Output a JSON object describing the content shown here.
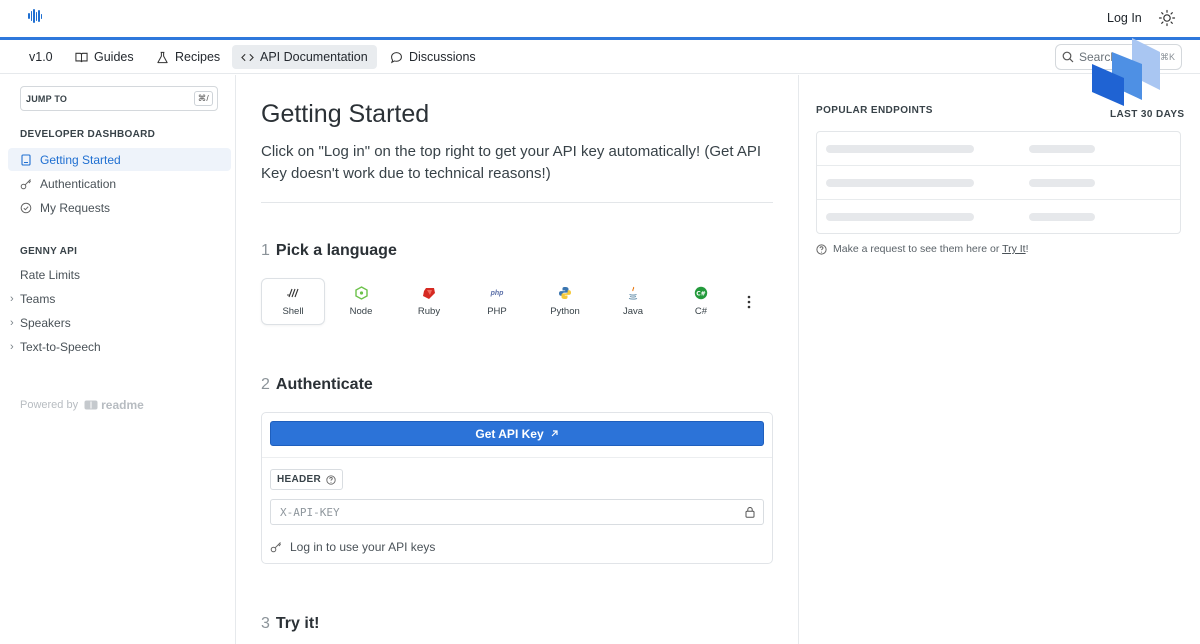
{
  "topbar": {
    "login_label": "Log In",
    "theme_icon": "sun-icon"
  },
  "nav": {
    "version": "v1.0",
    "items": [
      {
        "label": "Guides",
        "icon": "book-icon"
      },
      {
        "label": "Recipes",
        "icon": "flask-icon"
      },
      {
        "label": "API Documentation",
        "icon": "code-icon",
        "active": true
      },
      {
        "label": "Discussions",
        "icon": "chat-bubble-icon"
      }
    ],
    "search_placeholder": "Search",
    "search_shortcut": "⌘K"
  },
  "sidebar": {
    "jump_label": "JUMP TO",
    "jump_shortcut": "⌘/",
    "section1_title": "DEVELOPER DASHBOARD",
    "section1_items": [
      {
        "label": "Getting Started",
        "icon": "page-icon",
        "active": true
      },
      {
        "label": "Authentication",
        "icon": "key-icon"
      },
      {
        "label": "My Requests",
        "icon": "check-circle-icon"
      }
    ],
    "section2_title": "GENNY API",
    "rate_limits": "Rate Limits",
    "tree_items": [
      "Teams",
      "Speakers",
      "Text-to-Speech"
    ],
    "powered_by": "Powered by",
    "powered_brand": "readme"
  },
  "main": {
    "title": "Getting Started",
    "intro": "Click on \"Log in\" on the top right to get your API key automatically! (Get API Key doesn't work due to technical reasons!)",
    "step1": {
      "num": "1",
      "label": "Pick a language"
    },
    "step2": {
      "num": "2",
      "label": "Authenticate"
    },
    "step3": {
      "num": "3",
      "label": "Try it!"
    },
    "languages": [
      "Shell",
      "Node",
      "Ruby",
      "PHP",
      "Python",
      "Java",
      "C#"
    ],
    "api_button": "Get API Key",
    "header_tag": "HEADER",
    "key_placeholder": "X-API-KEY",
    "login_hint": "Log in to use your API keys"
  },
  "right": {
    "popular_title": "POPULAR ENDPOINTS",
    "range_label": "LAST 30 DAYS",
    "hint_text": "Make a request to see them here or ",
    "hint_link": "Try It",
    "hint_end": "!"
  },
  "colors": {
    "accent": "#2f78dc",
    "button": "#2c73d8",
    "active_bg": "#eef3fa"
  }
}
